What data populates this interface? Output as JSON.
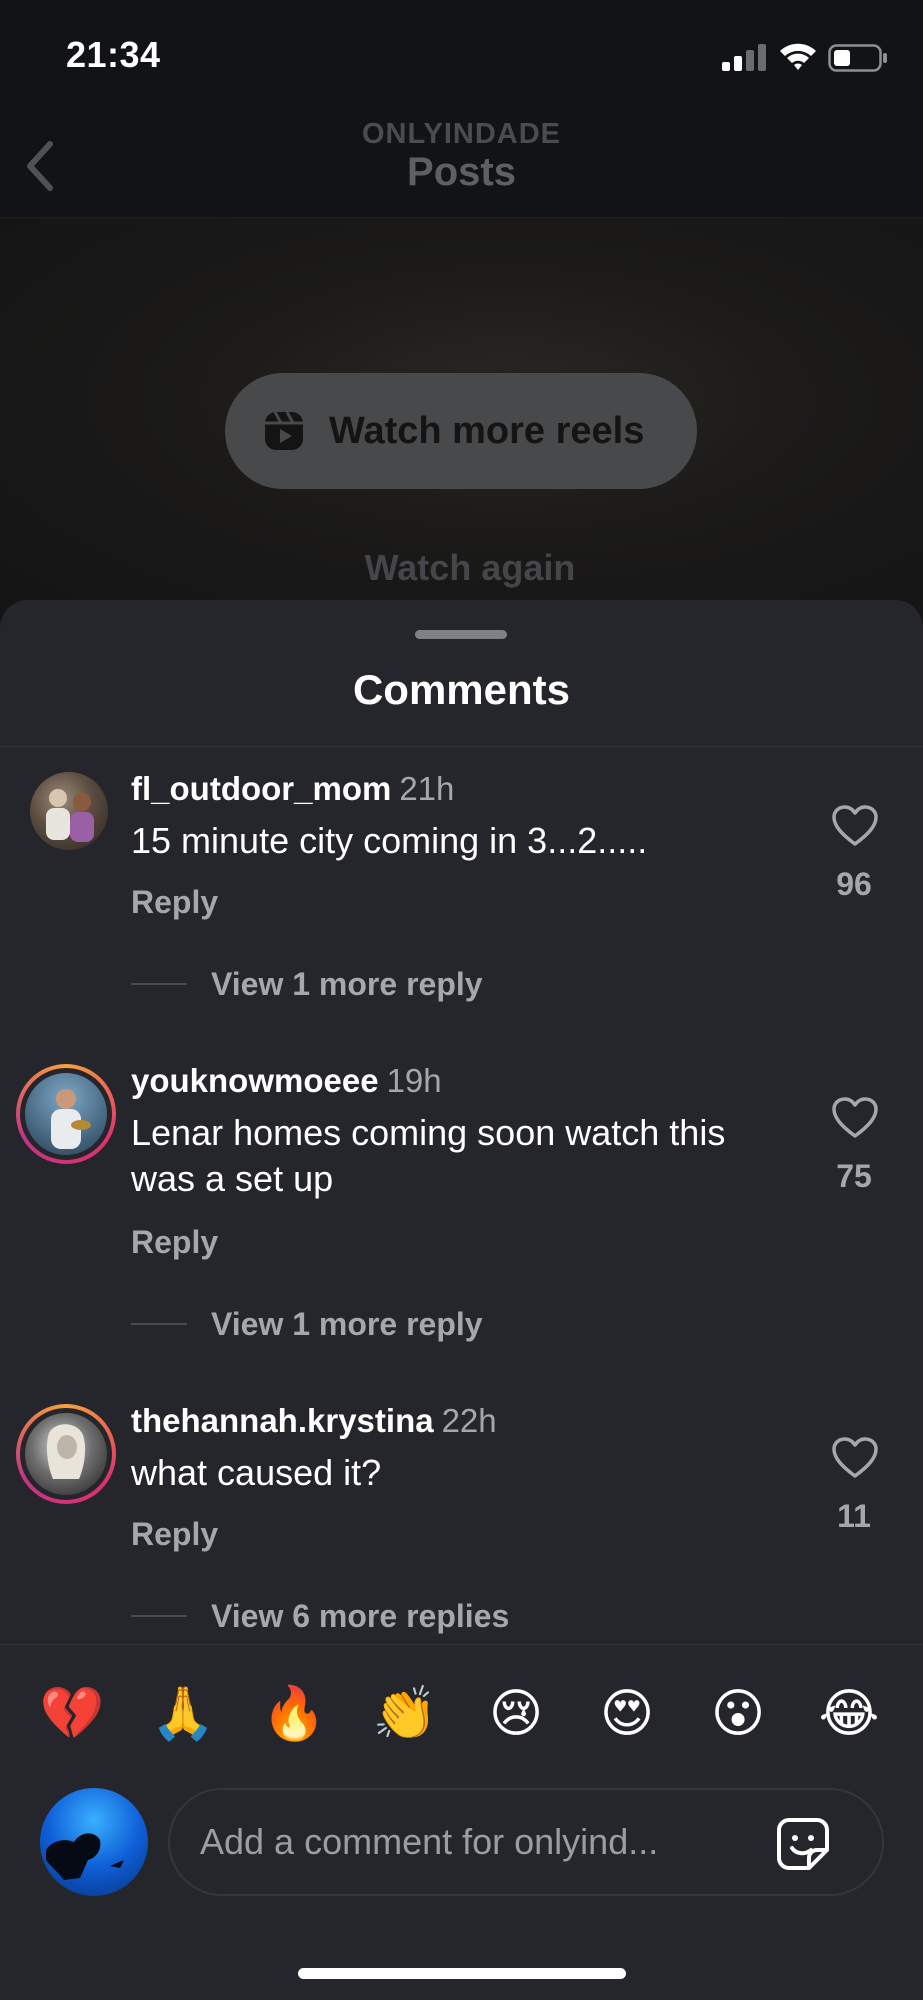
{
  "status_bar": {
    "time": "21:34",
    "icons": [
      "signal-icon",
      "wifi-icon",
      "battery-icon"
    ]
  },
  "header": {
    "account": "ONLYINDADE",
    "title": "Posts",
    "back_icon": "chevron-left-icon"
  },
  "video": {
    "watch_more_label": "Watch more reels",
    "watch_more_icon": "reels-icon",
    "watch_again_label": "Watch again"
  },
  "comments_sheet": {
    "title": "Comments",
    "comments": [
      {
        "username": "fl_outdoor_mom",
        "time": "21h",
        "text": "15 minute city coming in 3...2.....",
        "reply_label": "Reply",
        "likes": "96",
        "view_replies": "View 1 more reply"
      },
      {
        "username": "youknowmoeee",
        "time": "19h",
        "text": "Lenar homes coming soon watch this was a set up",
        "reply_label": "Reply",
        "likes": "75",
        "view_replies": "View 1 more reply"
      },
      {
        "username": "thehannah.krystina",
        "time": "22h",
        "text": "what caused it?",
        "reply_label": "Reply",
        "likes": "11",
        "view_replies": "View 6 more replies"
      }
    ]
  },
  "quick_reactions": [
    "💔",
    "🙏",
    "🔥",
    "👏",
    "😢",
    "😍",
    "😮",
    "😂"
  ],
  "composer": {
    "placeholder": "Add a comment for onlyind...",
    "sticker_icon": "sticker-icon"
  },
  "colors": {
    "sheet_bg": "#25262b",
    "secondary_text": "#a6a7ac",
    "story_ring": "#e1306c"
  }
}
